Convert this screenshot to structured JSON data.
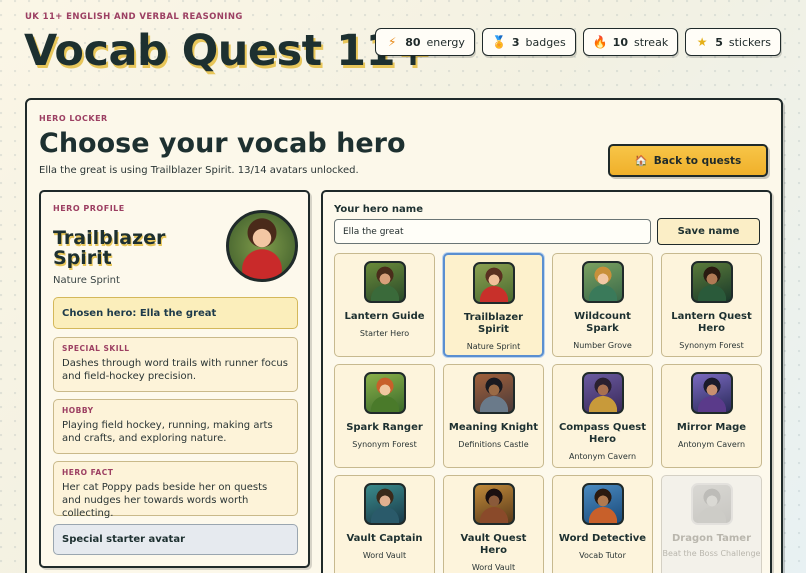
{
  "header": {
    "eyebrow": "UK 11+ ENGLISH AND VERBAL REASONING",
    "title": "Vocab Quest 11+"
  },
  "stats": [
    {
      "icon": "lightning-icon",
      "glyph": "⚡",
      "value": "80",
      "label": "energy"
    },
    {
      "icon": "medal-icon",
      "glyph": "🏅",
      "value": "3",
      "label": "badges"
    },
    {
      "icon": "flame-icon",
      "glyph": "🔥",
      "value": "10",
      "label": "streak"
    },
    {
      "icon": "star-icon",
      "glyph": "★",
      "value": "5",
      "label": "stickers"
    }
  ],
  "locker": {
    "eyebrow": "HERO LOCKER",
    "title": "Choose your vocab hero",
    "subtitle": "Ella the great is using Trailblazer Spirit. 13/14 avatars unlocked.",
    "back_label": "Back to quests",
    "back_icon": "house-icon"
  },
  "profile": {
    "eyebrow": "HERO PROFILE",
    "name": "Trailblazer Spirit",
    "place": "Nature Sprint",
    "chosen": "Chosen hero: Ella the great",
    "skill_label": "SPECIAL SKILL",
    "skill_text": "Dashes through word trails with runner focus and field-hockey precision.",
    "hobby_label": "HOBBY",
    "hobby_text": "Playing field hockey, running, making arts and crafts, and exploring nature.",
    "fact_label": "HERO FACT",
    "fact_text": "Her cat Poppy pads beside her on quests and nudges her towards words worth collecting.",
    "starter": "Special starter avatar"
  },
  "picker": {
    "name_label": "Your hero name",
    "name_value": "Ella the great",
    "save_label": "Save name",
    "heroes": [
      {
        "name": "Lantern Guide",
        "sub": "Starter Hero",
        "state": "unlocked"
      },
      {
        "name": "Trailblazer Spirit",
        "sub": "Nature Sprint",
        "state": "selected"
      },
      {
        "name": "Wildcount Spark",
        "sub": "Number Grove",
        "state": "unlocked"
      },
      {
        "name": "Lantern Quest Hero",
        "sub": "Synonym Forest",
        "state": "unlocked"
      },
      {
        "name": "Spark Ranger",
        "sub": "Synonym Forest",
        "state": "unlocked"
      },
      {
        "name": "Meaning Knight",
        "sub": "Definitions Castle",
        "state": "unlocked"
      },
      {
        "name": "Compass Quest Hero",
        "sub": "Antonym Cavern",
        "state": "unlocked"
      },
      {
        "name": "Mirror Mage",
        "sub": "Antonym Cavern",
        "state": "unlocked"
      },
      {
        "name": "Vault Captain",
        "sub": "Word Vault",
        "state": "unlocked"
      },
      {
        "name": "Vault Quest Hero",
        "sub": "Word Vault",
        "state": "unlocked"
      },
      {
        "name": "Word Detective",
        "sub": "Vocab Tutor",
        "state": "unlocked"
      },
      {
        "name": "Dragon Tamer",
        "sub": "Beat the Boss Challenge",
        "state": "locked"
      }
    ]
  },
  "colors": {
    "accent_gold": "#f0b02a",
    "eyebrow_pink": "#9c3f62",
    "ink": "#1f2a2a",
    "selected_blue": "#5a8fd0"
  }
}
